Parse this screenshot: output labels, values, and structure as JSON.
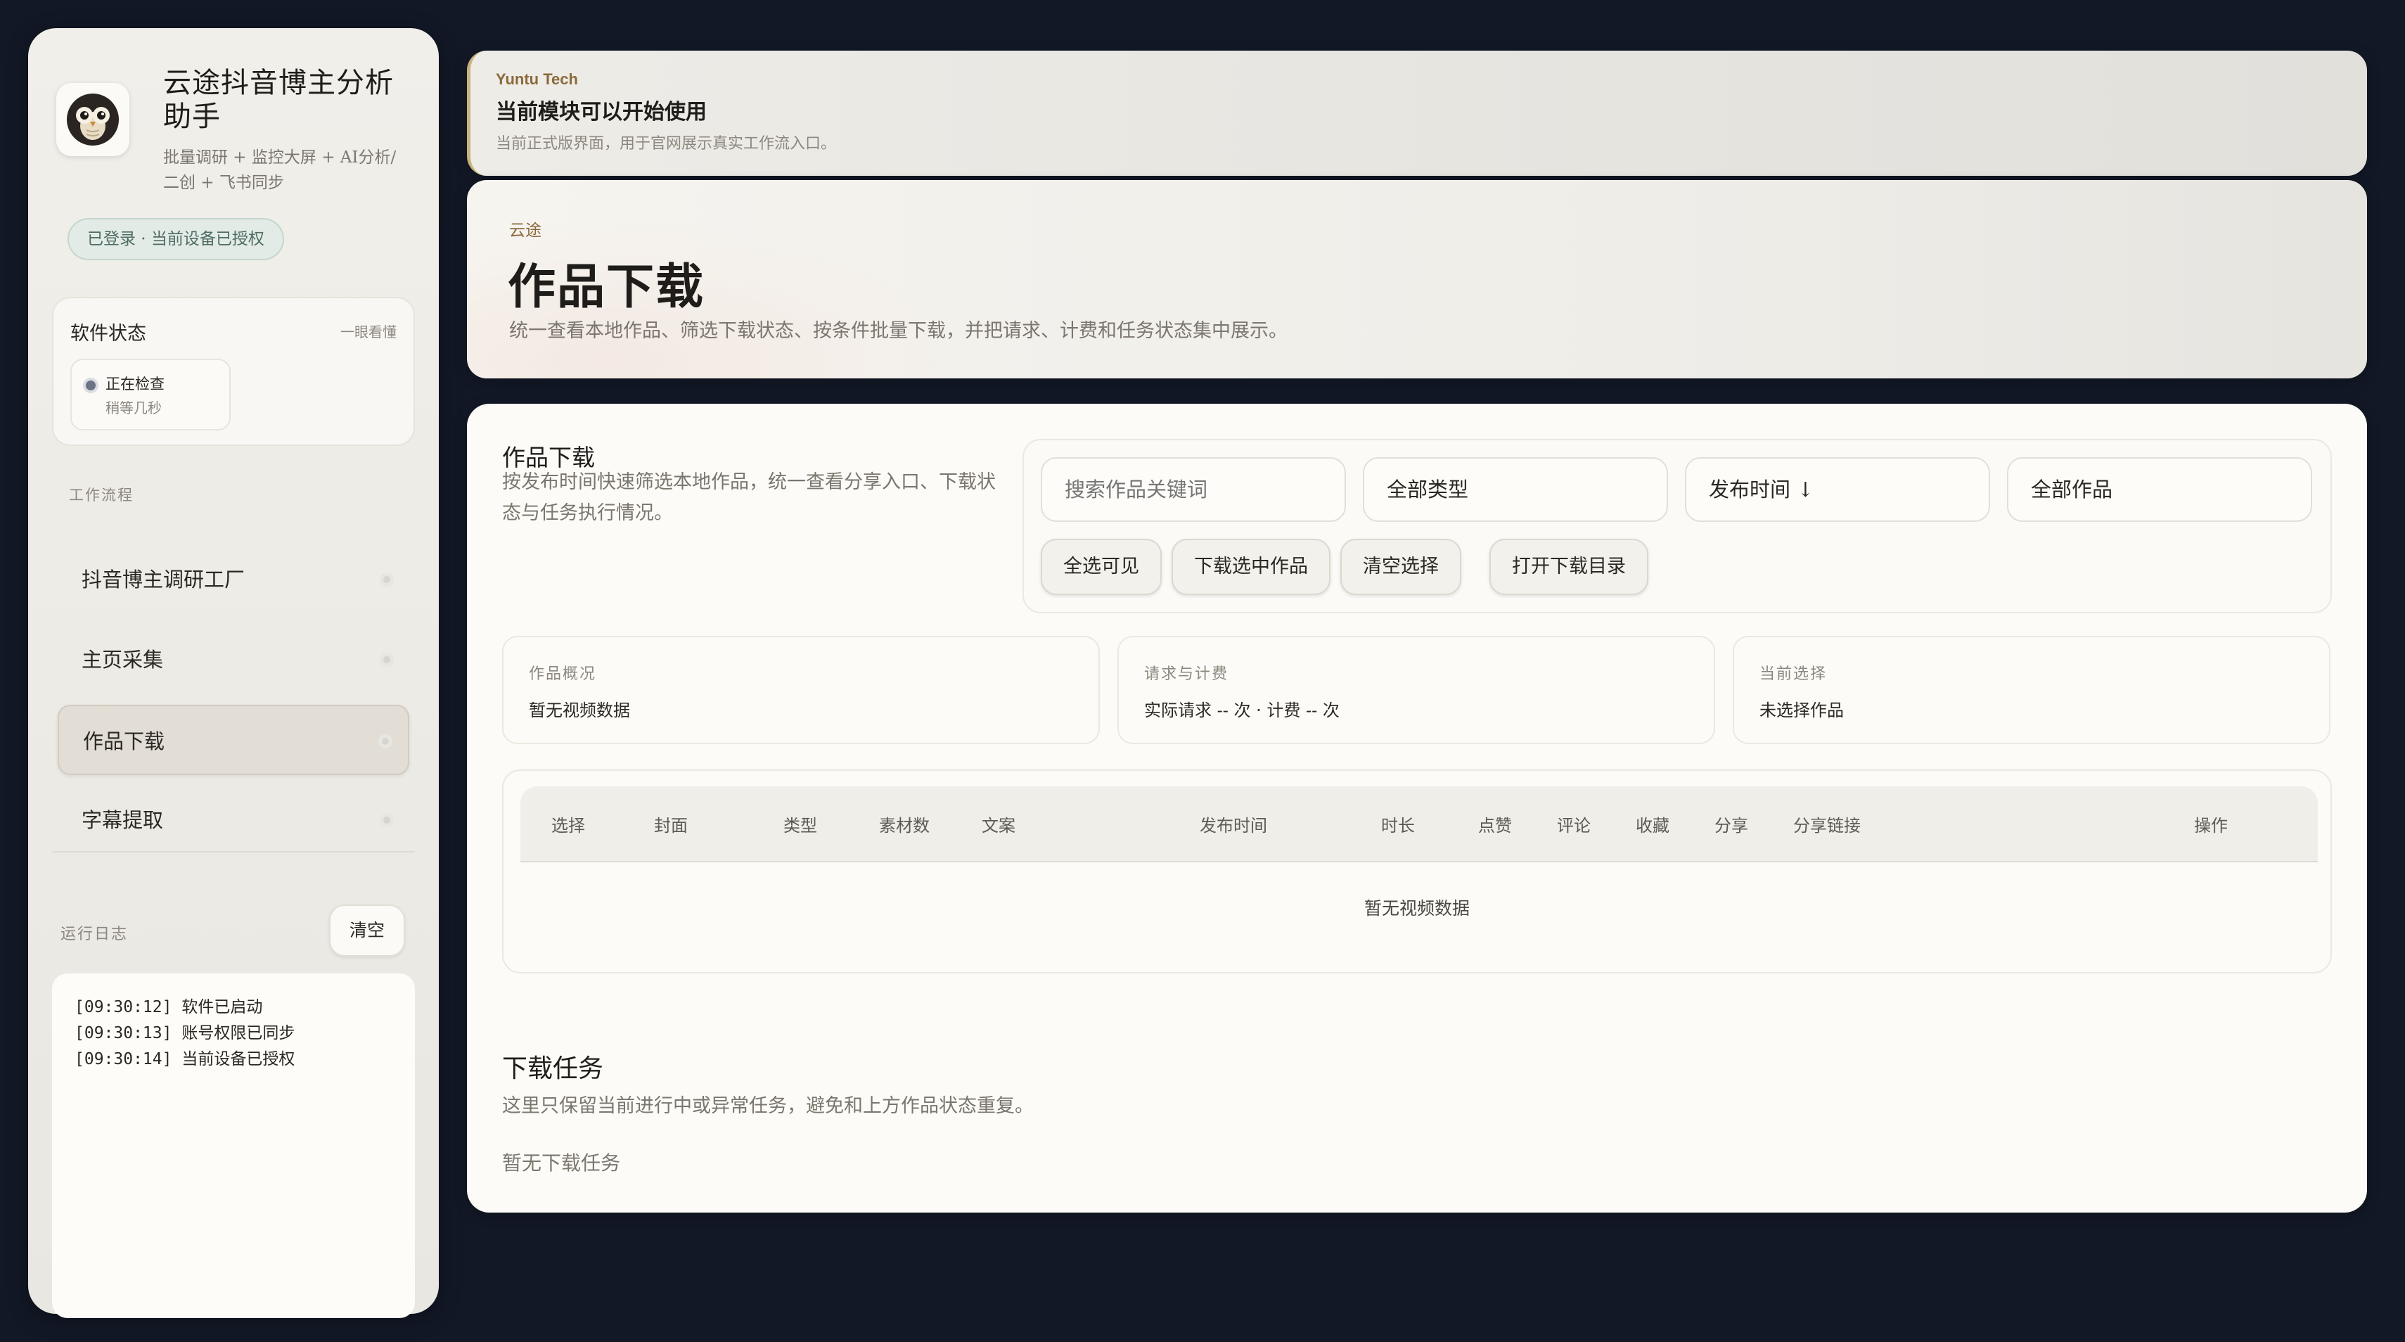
{
  "app": {
    "title": "云途抖音博主分析助手",
    "subtitle": "批量调研 + 监控大屏 + AI分析/二创 + 飞书同步",
    "auth_badge": "已登录 · 当前设备已授权"
  },
  "status_card": {
    "title": "软件状态",
    "hint": "一眼看懂",
    "status_text": "正在检查",
    "status_sub": "稍等几秒"
  },
  "nav": {
    "section_label": "工作流程",
    "items": [
      {
        "label": "抖音博主调研工厂"
      },
      {
        "label": "主页采集"
      },
      {
        "label": "作品下载"
      },
      {
        "label": "字幕提取"
      }
    ]
  },
  "log": {
    "label": "运行日志",
    "clear_label": "清空",
    "lines": [
      "[09:30:12] 软件已启动",
      "[09:30:13] 账号权限已同步",
      "[09:30:14] 当前设备已授权"
    ]
  },
  "banner": {
    "brand": "Yuntu Tech",
    "title": "当前模块可以开始使用",
    "desc": "当前正式版界面，用于官网展示真实工作流入口。"
  },
  "hero": {
    "kicker": "云途",
    "title": "作品下载",
    "desc": "统一查看本地作品、筛选下载状态、按条件批量下载，并把请求、计费和任务状态集中展示。"
  },
  "works": {
    "title": "作品下载",
    "desc": "按发布时间快速筛选本地作品，统一查看分享入口、下载状态与任务执行情况。",
    "search_placeholder": "搜索作品关键词",
    "type_select": "全部类型",
    "sort_select": "发布时间 ↓",
    "scope_select": "全部作品",
    "buttons": {
      "select_visible": "全选可见",
      "download_selected": "下载选中作品",
      "clear_selection": "清空选择",
      "open_dir": "打开下载目录"
    }
  },
  "stats": [
    {
      "label": "作品概况",
      "value": "暂无视频数据"
    },
    {
      "label": "请求与计费",
      "value": "实际请求 -- 次 · 计费 -- 次"
    },
    {
      "label": "当前选择",
      "value": "未选择作品"
    }
  ],
  "table": {
    "columns": [
      "选择",
      "封面",
      "类型",
      "素材数",
      "文案",
      "发布时间",
      "时长",
      "点赞",
      "评论",
      "收藏",
      "分享",
      "分享链接",
      "操作"
    ],
    "empty_text": "暂无视频数据"
  },
  "tasks": {
    "title": "下载任务",
    "desc": "这里只保留当前进行中或异常任务，避免和上方作品状态重复。",
    "empty_text": "暂无下载任务"
  }
}
